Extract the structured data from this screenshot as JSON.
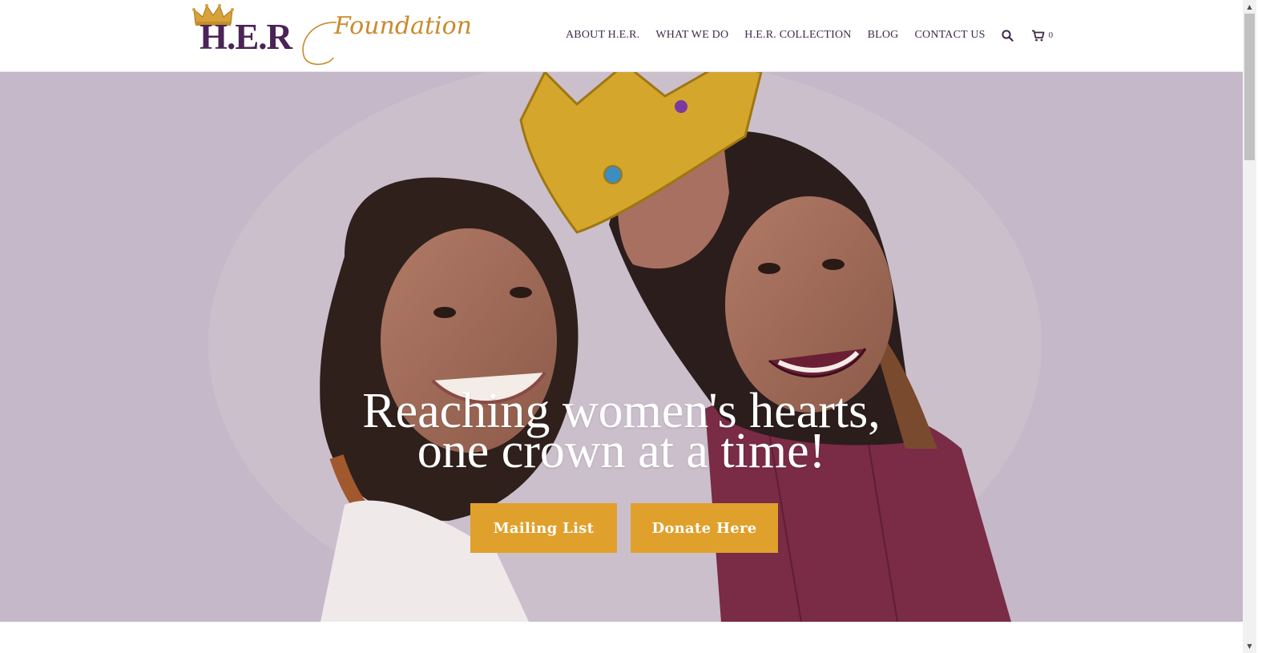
{
  "logo": {
    "primary": "H.E.R",
    "secondary": "Foundation",
    "primary_color": "#4a2456",
    "secondary_color": "#c98a2e",
    "crown_color": "#d8a23a"
  },
  "nav": {
    "items": [
      {
        "label": "ABOUT H.E.R."
      },
      {
        "label": "WHAT WE DO"
      },
      {
        "label": "H.E.R. COLLECTION"
      },
      {
        "label": "BLOG"
      },
      {
        "label": "CONTACT US"
      }
    ],
    "search_icon": "search-icon",
    "cart_icon": "cart-icon",
    "cart_count": "0"
  },
  "hero": {
    "headline_line1": "Reaching women's hearts,",
    "headline_line2": "one crown at a time!",
    "overlay_color": "#c5b8c8",
    "buttons": {
      "mailing": "Mailing List",
      "donate": "Donate Here"
    },
    "button_color": "#e0a02c"
  },
  "scrollbar": {
    "up_arrow": "▲",
    "down_arrow": "▼"
  }
}
